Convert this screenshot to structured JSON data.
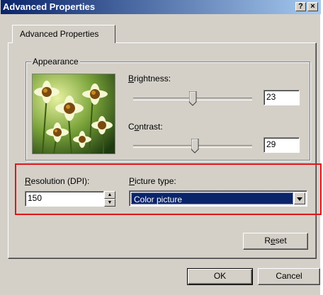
{
  "window": {
    "title": "Advanced Properties",
    "help_glyph": "?",
    "close_glyph": "×"
  },
  "tabs": [
    {
      "label": "Advanced Properties"
    }
  ],
  "appearance": {
    "group_label": "Appearance",
    "brightness": {
      "label": "Brightness:",
      "value": "23",
      "level": 0.5
    },
    "contrast": {
      "label": "Contrast:",
      "value": "29",
      "level": 0.52
    }
  },
  "resolution": {
    "label": "Resolution (DPI):",
    "value": "150"
  },
  "picture_type": {
    "label": "Picture type:",
    "selected": "Color picture"
  },
  "buttons": {
    "reset": "Reset",
    "ok": "OK",
    "cancel": "Cancel"
  },
  "colors": {
    "title_bar": "#0a246a",
    "selection": "#0a246a",
    "highlight_box": "#e0161b",
    "face": "#d4d0c8"
  }
}
